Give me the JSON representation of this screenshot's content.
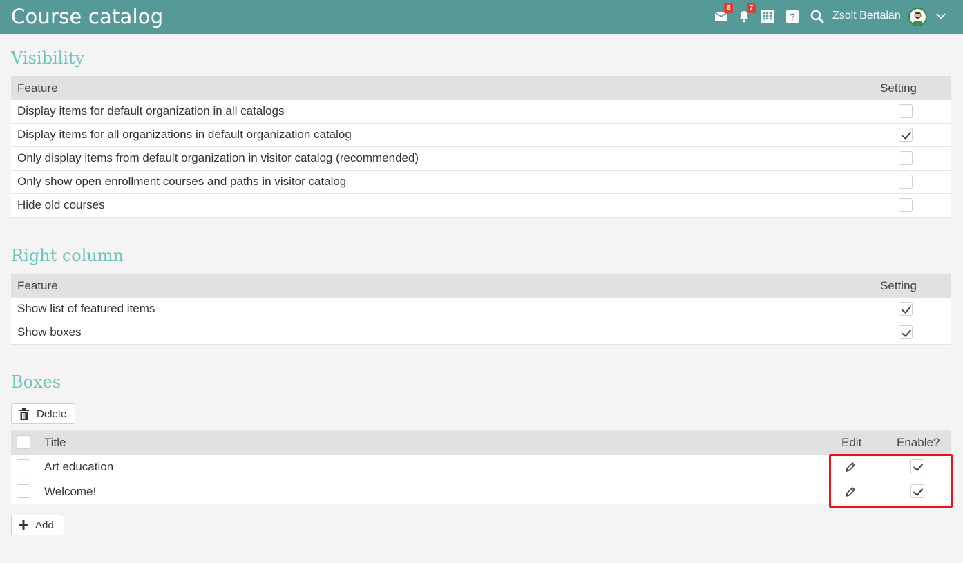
{
  "header": {
    "title": "Course catalog",
    "mail_badge": "6",
    "notif_badge": "7",
    "user_name": "Zsolt Bertalan",
    "icons": [
      "mail-icon",
      "bell-icon",
      "calendar-icon",
      "help-icon",
      "search-icon",
      "chevron-down-icon"
    ]
  },
  "visibility": {
    "title": "Visibility",
    "col_feature": "Feature",
    "col_setting": "Setting",
    "rows": [
      {
        "label": "Display items for default organization in all catalogs",
        "checked": false
      },
      {
        "label": "Display items for all organizations in default organization catalog",
        "checked": true
      },
      {
        "label": "Only display items from default organization in visitor catalog (recommended)",
        "checked": false
      },
      {
        "label": "Only show open enrollment courses and paths in visitor catalog",
        "checked": false
      },
      {
        "label": "Hide old courses",
        "checked": false
      }
    ]
  },
  "right_column": {
    "title": "Right column",
    "col_feature": "Feature",
    "col_setting": "Setting",
    "rows": [
      {
        "label": "Show list of featured items",
        "checked": true
      },
      {
        "label": "Show boxes",
        "checked": true
      }
    ]
  },
  "boxes": {
    "title": "Boxes",
    "delete_label": "Delete",
    "add_label": "Add",
    "col_title": "Title",
    "col_edit": "Edit",
    "col_enable": "Enable?",
    "rows": [
      {
        "title": "Art education",
        "enabled": true
      },
      {
        "title": "Welcome!",
        "enabled": true
      }
    ]
  },
  "colors": {
    "header_bg": "#559a96",
    "section_title": "#6cc3b9",
    "badge": "#d9413a",
    "highlight": "#e8141b"
  }
}
